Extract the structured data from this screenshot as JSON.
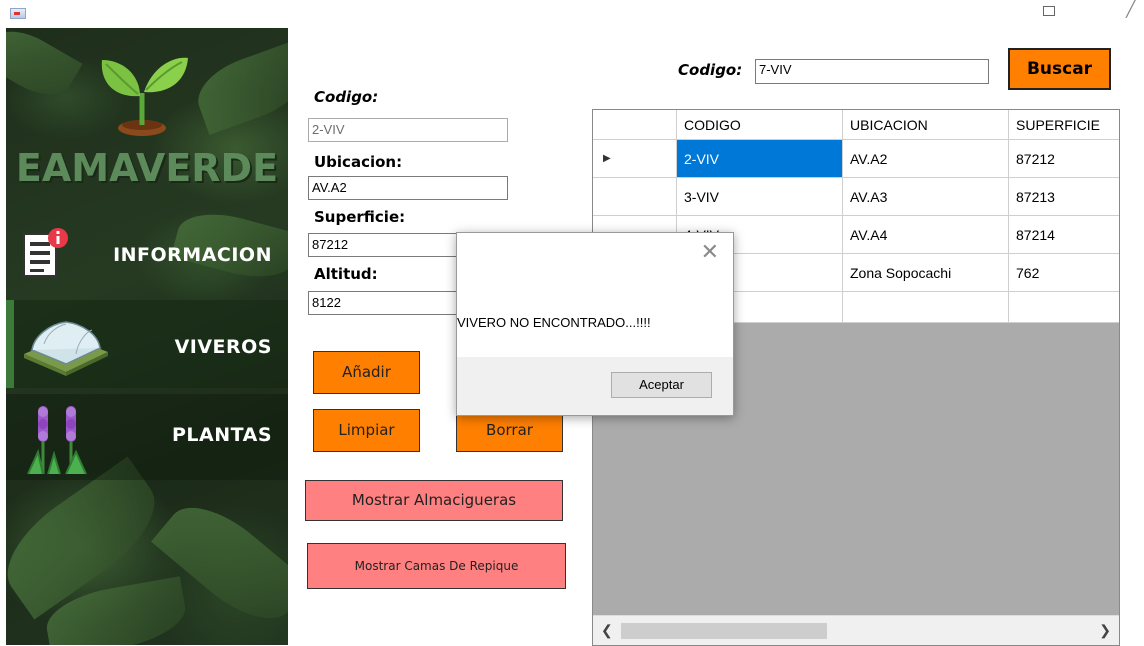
{
  "app": {
    "brand": "EAMAVERDE"
  },
  "nav": [
    {
      "label": "INFORMACION"
    },
    {
      "label": "VIVEROS"
    },
    {
      "label": "PLANTAS"
    }
  ],
  "form": {
    "codigo_label": "Codigo:",
    "codigo_value": "2-VIV",
    "ubicacion_label": "Ubicacion:",
    "ubicacion_value": "AV.A2",
    "superficie_label": "Superficie:",
    "superficie_value": "87212",
    "altitud_label": "Altitud:",
    "altitud_value": "8122"
  },
  "buttons": {
    "add": "Añadir",
    "clear": "Limpiar",
    "delete": "Borrar",
    "show_almacigueras": "Mostrar Almacigueras",
    "show_camas": "Mostrar Camas De Repique"
  },
  "search": {
    "label": "Codigo:",
    "value": "7-VIV",
    "button": "Buscar"
  },
  "grid": {
    "columns": [
      "",
      "CODIGO",
      "UBICACION",
      "SUPERFICIE"
    ],
    "rows": [
      {
        "marker": "▶",
        "cells": [
          "2-VIV",
          "AV.A2",
          "87212"
        ]
      },
      {
        "marker": "",
        "cells": [
          "3-VIV",
          "AV.A3",
          "87213"
        ]
      },
      {
        "marker": "",
        "cells": [
          "4-VIV",
          "AV.A4",
          "87214"
        ]
      },
      {
        "marker": "",
        "cells": [
          "",
          "Zona Sopocachi",
          "762"
        ]
      },
      {
        "marker": "",
        "cells": [
          "",
          "",
          ""
        ]
      }
    ]
  },
  "dialog": {
    "message": "VIVERO NO ENCONTRADO...!!!!",
    "ok": "Aceptar"
  },
  "icons": {
    "app": "app-icon",
    "maximize": "maximize-icon",
    "close": "close-icon",
    "dialog_close": "close-x-icon",
    "row_pointer": "triangle-right-icon",
    "scroll_left": "chevron-left-icon",
    "scroll_right": "chevron-right-icon"
  },
  "colors": {
    "accent_orange": "#ff7f00",
    "pink_button": "#ff8080",
    "selection": "#0078d7",
    "brand_green": "#5c8a5a"
  }
}
